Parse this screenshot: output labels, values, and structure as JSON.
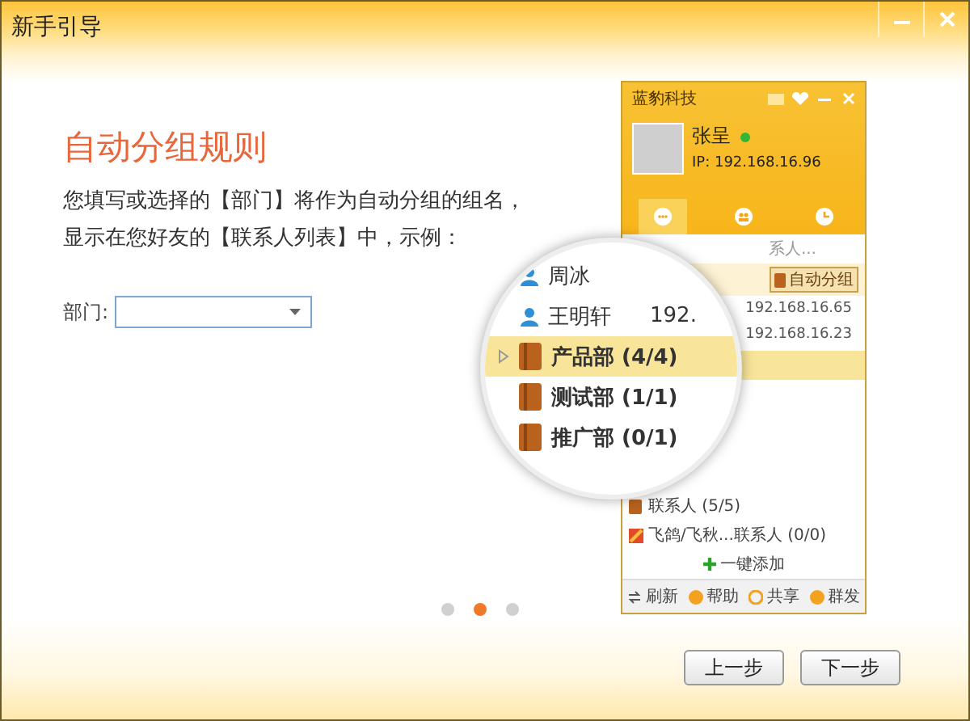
{
  "window": {
    "title": "新手引导"
  },
  "guide": {
    "heading": "自动分组规则",
    "description": [
      "您填写或选择的【部门】将作为自动分组的组名，",
      "显示在您好友的【联系人列表】中，示例："
    ],
    "field": {
      "label": "部门:"
    }
  },
  "preview": {
    "app_name": "蓝豹科技",
    "user_name": "张呈",
    "online": true,
    "ip": "IP: 192.168.16.96",
    "nav_tabs": [
      {
        "selected": true
      },
      {
        "selected": false
      },
      {
        "selected": false
      }
    ],
    "search_placeholder": "系人...",
    "auto_group_button": "自动分组",
    "contact_ips": [
      "192.168.16.65",
      "192.168.16.23"
    ],
    "groups": [
      "联系人 (5/5)",
      "飞鸽/飞秋...联系人 (0/0)"
    ],
    "add_button": "一键添加",
    "footer_buttons": [
      {
        "kind": "refresh",
        "label": "刷新"
      },
      {
        "kind": "help",
        "label": "帮助"
      },
      {
        "kind": "share",
        "label": "共享"
      },
      {
        "kind": "broadcast",
        "label": "群发"
      }
    ]
  },
  "magnifier": {
    "contacts": [
      {
        "name": "周冰"
      },
      {
        "name": "王明轩",
        "ip": "192."
      }
    ],
    "groups": [
      {
        "label": "产品部 (4/4)",
        "selected": true
      },
      {
        "label": "测试部 (1/1)",
        "selected": false
      },
      {
        "label": "推广部 (0/1)",
        "selected": false
      }
    ]
  },
  "pager": [
    {
      "selected": false
    },
    {
      "selected": true
    },
    {
      "selected": false
    }
  ],
  "buttons": [
    "上一步",
    "下一步"
  ]
}
